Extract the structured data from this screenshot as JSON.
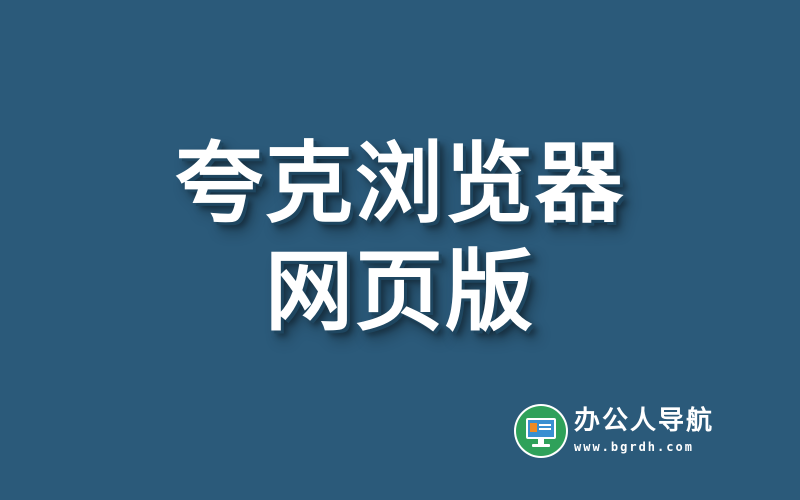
{
  "headline": {
    "line1": "夸克浏览器",
    "line2": "网页版"
  },
  "brand": {
    "logo_icon": "monitor-icon",
    "name": "办公人导航",
    "url": "www.bgrdh.com"
  },
  "colors": {
    "background": "#2b5a7a",
    "text": "#ffffff",
    "logo_green": "#2fa15a",
    "logo_screen": "#3a8fd1",
    "logo_orange": "#f08a24"
  }
}
